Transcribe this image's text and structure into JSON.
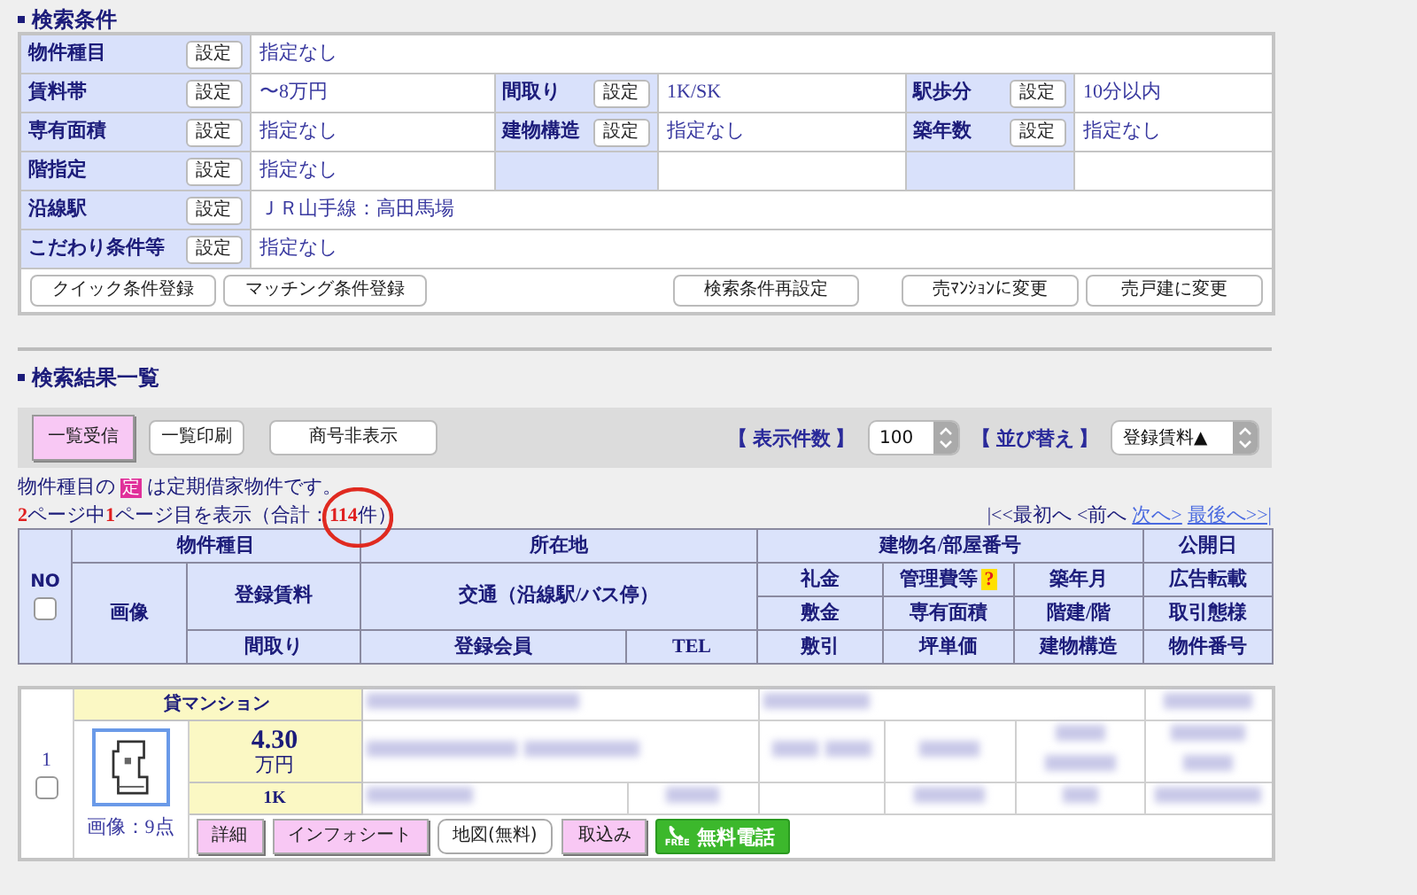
{
  "search_conditions": {
    "title": "検索条件",
    "rows": [
      [
        {
          "kind": "field",
          "label": "物件種目",
          "button": "設定",
          "value": "指定なし"
        }
      ],
      [
        {
          "kind": "field",
          "label": "賃料帯",
          "button": "設定",
          "value": "〜8万円"
        },
        {
          "kind": "field",
          "label": "間取り",
          "button": "設定",
          "value": "1K/SK"
        },
        {
          "kind": "field",
          "label": "駅歩分",
          "button": "設定",
          "value": "10分以内"
        }
      ],
      [
        {
          "kind": "field",
          "label": "専有面積",
          "button": "設定",
          "value": "指定なし"
        },
        {
          "kind": "field",
          "label": "建物構造",
          "button": "設定",
          "value": "指定なし"
        },
        {
          "kind": "field",
          "label": "築年数",
          "button": "設定",
          "value": "指定なし"
        }
      ],
      [
        {
          "kind": "field",
          "label": "階指定",
          "button": "設定",
          "value": "指定なし"
        },
        {
          "kind": "blank"
        },
        {
          "kind": "blank"
        }
      ],
      [
        {
          "kind": "field",
          "label": "沿線駅",
          "button": "設定",
          "value": "ＪＲ山手線：高田馬場"
        }
      ],
      [
        {
          "kind": "field",
          "label": "こだわり条件等",
          "button": "設定",
          "value": "指定なし"
        }
      ]
    ],
    "actions_left": [
      "クイック条件登録",
      "マッチング条件登録"
    ],
    "actions_right": [
      "検索条件再設定",
      "売ﾏﾝｼｮﾝに変更",
      "売戸建に変更"
    ]
  },
  "results": {
    "title": "検索結果一覧",
    "toolbar_buttons": [
      {
        "label": "一覧受信",
        "kind": "pink"
      },
      {
        "label": "一覧印刷",
        "kind": "plain"
      },
      {
        "label": "商号非表示",
        "kind": "wide"
      }
    ],
    "count_label": "【 表示件数 】",
    "count_value": "100",
    "sort_label": "【 並び替え 】",
    "sort_value": "登録賃料▲",
    "notice": {
      "before": "物件種目の",
      "badge": "定",
      "after": "は定期借家物件です。"
    },
    "summary": [
      {
        "text": "2",
        "highlight": true
      },
      {
        "text": "ページ中",
        "highlight": false
      },
      {
        "text": "1",
        "highlight": true
      },
      {
        "text": "ページ目を表示（合計：",
        "highlight": false
      },
      {
        "text": "114",
        "highlight": true
      },
      {
        "text": "件）",
        "highlight": false
      }
    ],
    "pager": [
      {
        "label": "|<<最初へ",
        "link": false
      },
      {
        "label": "<前へ",
        "link": false
      },
      {
        "label": "次へ>",
        "link": true
      },
      {
        "label": "最後へ>>|",
        "link": true
      }
    ],
    "header": {
      "select_all_checked": false,
      "cells": [
        {
          "label": "NO"
        },
        {
          "label": "物件種目"
        },
        {
          "label": "所在地"
        },
        {
          "label": "建物名/部屋番号"
        },
        {
          "label": "公開日"
        },
        {
          "label": "画像"
        },
        {
          "label": "登録賃料"
        },
        {
          "label": "交通（沿線駅/バス停）"
        },
        {
          "label": "礼金"
        },
        {
          "label": "管理費等",
          "help": "?"
        },
        {
          "label": "築年月"
        },
        {
          "label": "広告転載"
        },
        {
          "label": "敷金"
        },
        {
          "label": "専有面積"
        },
        {
          "label": "階建/階"
        },
        {
          "label": "取引態様"
        },
        {
          "label": "間取り"
        },
        {
          "label": "登録会員"
        },
        {
          "label": "TEL"
        },
        {
          "label": "敷引"
        },
        {
          "label": "坪単価"
        },
        {
          "label": "建物構造"
        },
        {
          "label": "物件番号"
        }
      ]
    },
    "rows": [
      {
        "number": "1",
        "checked": false,
        "type": "貸マンション",
        "rent": "4.30",
        "rent_unit": "万円",
        "layout": "1K",
        "photos": "画像：9点",
        "buttons": [
          {
            "label": "詳細",
            "kind": "pink"
          },
          {
            "label": "インフォシート",
            "kind": "pink"
          },
          {
            "label": "地図(無料)",
            "kind": "plain"
          },
          {
            "label": "取込み",
            "kind": "pink"
          },
          {
            "label": "無料電話",
            "kind": "phone",
            "badge": "FREE"
          }
        ]
      }
    ]
  }
}
